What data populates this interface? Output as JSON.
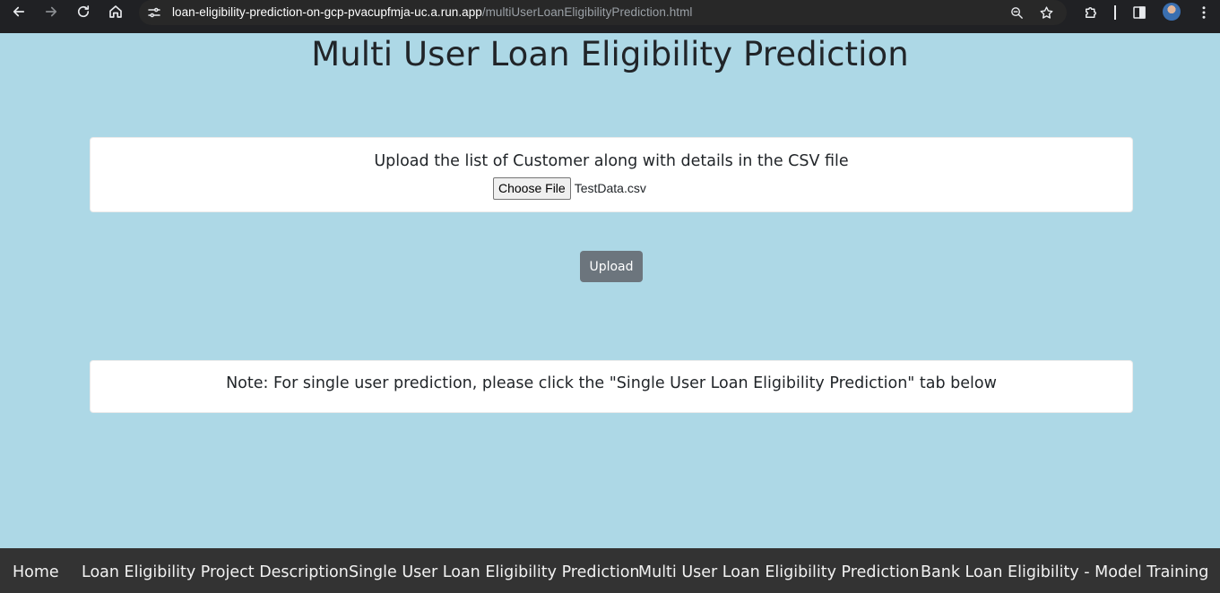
{
  "browser": {
    "url_host": "loan-eligibility-prediction-on-gcp-pvacupfmja-uc.a.run.app",
    "url_path": "/multiUserLoanEligibilityPrediction.html",
    "icons": [
      "back-icon",
      "forward-icon",
      "reload-icon",
      "home-icon",
      "site-settings-icon",
      "zoom-icon",
      "bookmark-star-icon",
      "extensions-icon",
      "side-panel-icon",
      "profile-avatar",
      "menu-icon"
    ]
  },
  "page": {
    "title": "Multi User Loan Eligibility Prediction"
  },
  "upload_card": {
    "heading": "Upload the list of Customer along with details in the CSV file",
    "choose_file_label": "Choose File",
    "file_name": "TestData.csv"
  },
  "upload_button": {
    "label": "Upload"
  },
  "note_card": {
    "text": "Note: For single user prediction, please click the \"Single User Loan Eligibility Prediction\" tab below"
  },
  "bottom_nav": {
    "items": [
      {
        "label": "Home"
      },
      {
        "label": "Loan Eligibility Project Description"
      },
      {
        "label": "Single User Loan Eligibility Prediction"
      },
      {
        "label": "Multi User Loan Eligibility Prediction"
      },
      {
        "label": "Bank Loan Eligibility - Model Training"
      }
    ]
  },
  "colors": {
    "page_background": "#add8e6",
    "card_background": "#ffffff",
    "upload_button": "#6c757d",
    "bottom_nav": "#333333",
    "browser_chrome": "#202124"
  }
}
